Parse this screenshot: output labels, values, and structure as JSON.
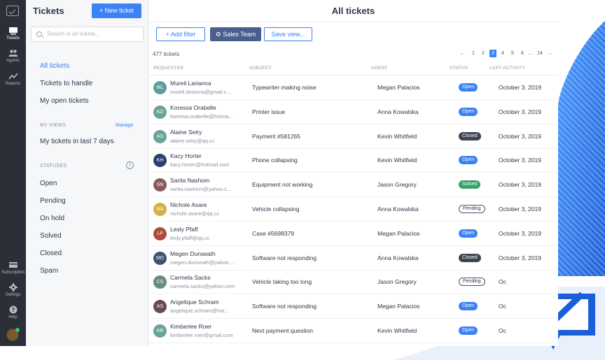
{
  "colors": {
    "accent": "#3b82f6",
    "rail": "#2b2f38",
    "open": "#3b82f6",
    "closed": "#3d4452",
    "solved": "#38a169"
  },
  "rail": [
    {
      "label": "Tickets",
      "icon": "tickets-icon"
    },
    {
      "label": "Agents",
      "icon": "agents-icon"
    },
    {
      "label": "Reports",
      "icon": "reports-icon"
    },
    {
      "label": "Subscription",
      "icon": "subscription-icon"
    },
    {
      "label": "Settings",
      "icon": "gear-icon"
    },
    {
      "label": "Help",
      "icon": "help-icon"
    }
  ],
  "sidebar": {
    "title": "Tickets",
    "new_ticket": "+ New ticket",
    "search_placeholder": "Search in all tickets...",
    "views": [
      "All tickets",
      "Tickets to handle",
      "My open tickets"
    ],
    "my_views_header": "MY VIEWS",
    "manage": "Manage",
    "my_views": [
      "My tickets in last 7 days"
    ],
    "statuses_header": "STATUSES",
    "statuses": [
      "Open",
      "Pending",
      "On hold",
      "Solved",
      "Closed",
      "Spam"
    ]
  },
  "main": {
    "title": "All tickets",
    "add_filter": "Add filter",
    "team_filter": "Sales Team",
    "save_view": "Save view...",
    "count": "477 tickets",
    "pages": [
      "1",
      "2",
      "3",
      "4",
      "5",
      "6",
      "...",
      "24"
    ],
    "current_page": "3",
    "columns": [
      "REQUESTER",
      "SUBJECT",
      "AGENT",
      "STATUS",
      "LAST ACTIVITY"
    ]
  },
  "tickets": [
    {
      "initials": "ML",
      "color": "#5f9ea0",
      "name": "Mureil Larianna",
      "email": "mureil.larianna@gmail.c...",
      "subject": "Typewriter making noise",
      "agent": "Megan Palacios",
      "status": "Open",
      "activity": "October 3, 2019"
    },
    {
      "initials": "KO",
      "color": "#6aa39a",
      "name": "Koressa Orabelle",
      "email": "koressa.orabelle@hotma...",
      "subject": "Printer issue",
      "agent": "Anna Kowalska",
      "status": "Open",
      "activity": "October 3, 2019"
    },
    {
      "initials": "AS",
      "color": "#6aa39a",
      "name": "Alaine Selry",
      "email": "alaine.selry@qq.cc",
      "subject": "Payment #581265",
      "agent": "Kevin Whitfield",
      "status": "Closed",
      "activity": "October 3, 2019"
    },
    {
      "initials": "KH",
      "color": "#2c3e70",
      "name": "Kacy Horter",
      "email": "kacy.horter@hotmail.com",
      "subject": "Phone collapsing",
      "agent": "Kevin Whitfield",
      "status": "Open",
      "activity": "October 3, 2019"
    },
    {
      "initials": "SN",
      "color": "#8a5a5a",
      "name": "Sarita Nashom",
      "email": "sarita.nashom@yahoo.c...",
      "subject": "Equipment not working",
      "agent": "Jason Gregory",
      "status": "Solved",
      "activity": "October 3, 2019"
    },
    {
      "initials": "NA",
      "color": "#d4b04a",
      "name": "Nichole Asare",
      "email": "nichole.asare@qq.cc",
      "subject": "Vehicle collapsing",
      "agent": "Anna Kowalska",
      "status": "Pending",
      "activity": "October 3, 2019"
    },
    {
      "initials": "LP",
      "color": "#b04a3a",
      "name": "Lesly Pfaff",
      "email": "lesly.pfaff@qq.cc",
      "subject": "Case #5698379",
      "agent": "Megan Palacios",
      "status": "Open",
      "activity": "October 3, 2019"
    },
    {
      "initials": "MD",
      "color": "#3d5570",
      "name": "Megen Dunseath",
      "email": "megen.dunseath@yahoo....",
      "subject": "Software not responding",
      "agent": "Anna Kowalska",
      "status": "Closed",
      "activity": "October 3, 2019"
    },
    {
      "initials": "CS",
      "color": "#6a8a80",
      "name": "Carmela Sacks",
      "email": "carmela.sacks@yahoo.com",
      "subject": "Vehicle taking too long",
      "agent": "Jason Gregory",
      "status": "Pending",
      "activity": "Oc"
    },
    {
      "initials": "AS",
      "color": "#6a4a5a",
      "name": "Angelique Schram",
      "email": "angelique.schram@hot...",
      "subject": "Software not responding",
      "agent": "Megan Palacios",
      "status": "Open",
      "activity": "Oc"
    },
    {
      "initials": "KR",
      "color": "#6aa39a",
      "name": "Kimberlee Roer",
      "email": "kimberlee.roer@gmail.com",
      "subject": "Next payment question",
      "agent": "Kevin Whitfield",
      "status": "Open",
      "activity": "Oc"
    }
  ]
}
